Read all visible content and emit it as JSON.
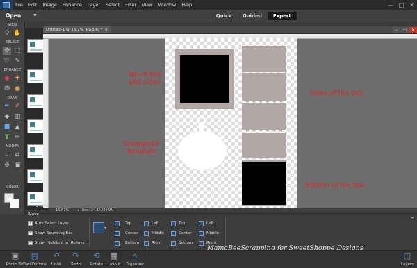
{
  "menubar": {
    "items": [
      "File",
      "Edit",
      "Image",
      "Enhance",
      "Layer",
      "Select",
      "Filter",
      "View",
      "Window",
      "Help"
    ],
    "window_controls": [
      "—",
      "□",
      "✕"
    ]
  },
  "modebar": {
    "open_label": "Open",
    "modes": [
      {
        "label": "Quick",
        "active": false
      },
      {
        "label": "Guided",
        "active": false
      },
      {
        "label": "Expert",
        "active": true
      }
    ]
  },
  "toolbox": {
    "sections": [
      "VIEW",
      "SELECT",
      "ENHANCE",
      "DRAW",
      "MODIFY",
      "COLOR"
    ]
  },
  "document": {
    "tab_title": "Untitled-1 @ 16.7% (RGB/8) *",
    "left_ruler_readout": "24.688"
  },
  "annotations": {
    "top_of_box": "Top of box\nand sides",
    "sides_of_box": "Sides of the box",
    "snowglobe": "Snowglobe\nTemplate",
    "bottom_of_box": "Bottom of the box"
  },
  "status": {
    "zoom": "16.67%",
    "doc_size": "Doc: 24.1M/24.9M"
  },
  "tool_options": {
    "tool_name": "Move",
    "checkboxes": [
      "Auto Select Layer",
      "Show Bounding Box",
      "Show Highlight on Rollover"
    ],
    "align_rows": [
      [
        "Top",
        "Left",
        "Top",
        "Left"
      ],
      [
        "Center",
        "Middle",
        "Center",
        "Middle"
      ],
      [
        "Bottom",
        "Right",
        "Bottom",
        "Right"
      ]
    ]
  },
  "taskbar": {
    "items": [
      {
        "label": "Photo Bin",
        "icon": "photo-bin-icon"
      },
      {
        "label": "Tool Options",
        "icon": "tool-options-icon"
      },
      {
        "label": "Undo",
        "icon": "undo-icon"
      },
      {
        "label": "Redo",
        "icon": "redo-icon"
      },
      {
        "label": "Rotate",
        "icon": "rotate-icon"
      },
      {
        "label": "Layout",
        "icon": "layout-icon"
      },
      {
        "label": "Organizer",
        "icon": "organizer-icon"
      },
      {
        "label": "Layers",
        "icon": "layers-icon"
      }
    ]
  },
  "watermark": "MamaBeeScrapping for SweetShoppe Designs",
  "colors": {
    "annotation_red": "#e4242a",
    "workspace_gray": "#6d6d6d",
    "frame_taupe": "#b1a7a5",
    "frame_gray": "#a9a5a4"
  }
}
